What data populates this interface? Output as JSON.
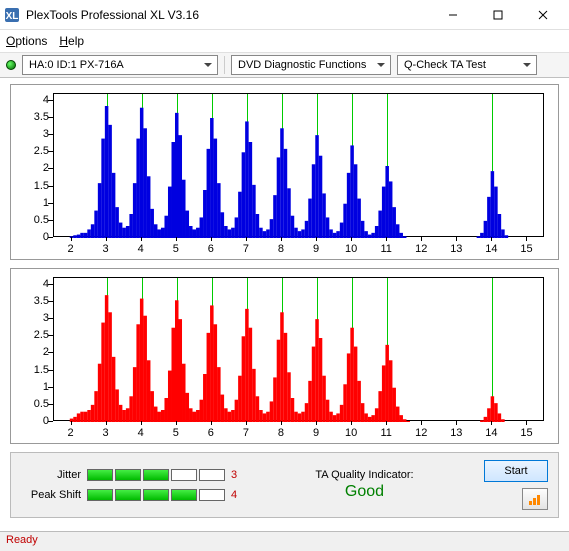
{
  "window": {
    "title": "PlexTools Professional XL V3.16"
  },
  "menu": {
    "options": "Options",
    "help": "Help"
  },
  "toolbar": {
    "drive": "HA:0 ID:1  PX-716A",
    "function_group": "DVD Diagnostic Functions",
    "test": "Q-Check TA Test"
  },
  "chart_data": [
    {
      "type": "bar",
      "color": "#0000e0",
      "xlim": [
        1.5,
        15.5
      ],
      "ylim": [
        0,
        4.2
      ],
      "xticks": [
        2,
        3,
        4,
        5,
        6,
        7,
        8,
        9,
        10,
        11,
        12,
        13,
        14,
        15
      ],
      "yticks": [
        0,
        0.5,
        1,
        1.5,
        2,
        2.5,
        3,
        3.5,
        4
      ],
      "gridlines_x": [
        3,
        4,
        5,
        6,
        7,
        8,
        9,
        10,
        11,
        14
      ],
      "series": [
        {
          "name": "top",
          "x": [
            2.0,
            2.1,
            2.2,
            2.3,
            2.4,
            2.5,
            2.6,
            2.7,
            2.8,
            2.9,
            3.0,
            3.1,
            3.2,
            3.3,
            3.4,
            3.5,
            3.6,
            3.7,
            3.8,
            3.9,
            4.0,
            4.1,
            4.2,
            4.3,
            4.4,
            4.5,
            4.6,
            4.7,
            4.8,
            4.9,
            5.0,
            5.1,
            5.2,
            5.3,
            5.4,
            5.5,
            5.6,
            5.7,
            5.8,
            5.9,
            6.0,
            6.1,
            6.2,
            6.3,
            6.4,
            6.5,
            6.6,
            6.7,
            6.8,
            6.9,
            7.0,
            7.1,
            7.2,
            7.3,
            7.4,
            7.5,
            7.6,
            7.7,
            7.8,
            7.9,
            8.0,
            8.1,
            8.2,
            8.3,
            8.4,
            8.5,
            8.6,
            8.7,
            8.8,
            8.9,
            9.0,
            9.1,
            9.2,
            9.3,
            9.4,
            9.5,
            9.6,
            9.7,
            9.8,
            9.9,
            10.0,
            10.1,
            10.2,
            10.3,
            10.4,
            10.5,
            10.6,
            10.7,
            10.8,
            10.9,
            11.0,
            11.1,
            11.2,
            11.3,
            11.4,
            11.5,
            13.6,
            13.7,
            13.8,
            13.9,
            14.0,
            14.1,
            14.2,
            14.3,
            14.4
          ],
          "y": [
            0.05,
            0.08,
            0.1,
            0.15,
            0.15,
            0.25,
            0.4,
            0.8,
            1.6,
            2.9,
            3.85,
            3.3,
            1.9,
            0.9,
            0.45,
            0.3,
            0.35,
            0.7,
            1.6,
            2.9,
            3.8,
            3.2,
            1.8,
            0.85,
            0.4,
            0.25,
            0.3,
            0.65,
            1.5,
            2.8,
            3.65,
            3.0,
            1.7,
            0.8,
            0.35,
            0.25,
            0.3,
            0.6,
            1.4,
            2.6,
            3.5,
            2.9,
            1.6,
            0.75,
            0.35,
            0.25,
            0.3,
            0.6,
            1.35,
            2.5,
            3.4,
            2.8,
            1.55,
            0.7,
            0.3,
            0.2,
            0.25,
            0.55,
            1.25,
            2.35,
            3.2,
            2.6,
            1.45,
            0.65,
            0.3,
            0.2,
            0.25,
            0.5,
            1.15,
            2.15,
            3.0,
            2.4,
            1.3,
            0.6,
            0.25,
            0.15,
            0.2,
            0.45,
            1.0,
            1.9,
            2.7,
            2.15,
            1.15,
            0.5,
            0.2,
            0.1,
            0.15,
            0.35,
            0.8,
            1.5,
            2.1,
            1.65,
            0.9,
            0.4,
            0.15,
            0.05,
            0.05,
            0.15,
            0.5,
            1.2,
            1.95,
            1.5,
            0.7,
            0.25,
            0.08
          ]
        }
      ]
    },
    {
      "type": "bar",
      "color": "#ff0000",
      "xlim": [
        1.5,
        15.5
      ],
      "ylim": [
        0,
        4.2
      ],
      "xticks": [
        2,
        3,
        4,
        5,
        6,
        7,
        8,
        9,
        10,
        11,
        12,
        13,
        14,
        15
      ],
      "yticks": [
        0,
        0.5,
        1,
        1.5,
        2,
        2.5,
        3,
        3.5,
        4
      ],
      "gridlines_x": [
        3,
        4,
        5,
        6,
        7,
        8,
        9,
        10,
        11,
        14
      ],
      "series": [
        {
          "name": "bottom",
          "x": [
            2.0,
            2.1,
            2.2,
            2.3,
            2.4,
            2.5,
            2.6,
            2.7,
            2.8,
            2.9,
            3.0,
            3.1,
            3.2,
            3.3,
            3.4,
            3.5,
            3.6,
            3.7,
            3.8,
            3.9,
            4.0,
            4.1,
            4.2,
            4.3,
            4.4,
            4.5,
            4.6,
            4.7,
            4.8,
            4.9,
            5.0,
            5.1,
            5.2,
            5.3,
            5.4,
            5.5,
            5.6,
            5.7,
            5.8,
            5.9,
            6.0,
            6.1,
            6.2,
            6.3,
            6.4,
            6.5,
            6.6,
            6.7,
            6.8,
            6.9,
            7.0,
            7.1,
            7.2,
            7.3,
            7.4,
            7.5,
            7.6,
            7.7,
            7.8,
            7.9,
            8.0,
            8.1,
            8.2,
            8.3,
            8.4,
            8.5,
            8.6,
            8.7,
            8.8,
            8.9,
            9.0,
            9.1,
            9.2,
            9.3,
            9.4,
            9.5,
            9.6,
            9.7,
            9.8,
            9.9,
            10.0,
            10.1,
            10.2,
            10.3,
            10.4,
            10.5,
            10.6,
            10.7,
            10.8,
            10.9,
            11.0,
            11.1,
            11.2,
            11.3,
            11.4,
            11.5,
            11.6,
            13.7,
            13.8,
            13.9,
            14.0,
            14.1,
            14.2,
            14.3
          ],
          "y": [
            0.1,
            0.15,
            0.25,
            0.3,
            0.3,
            0.35,
            0.5,
            0.9,
            1.7,
            2.9,
            3.7,
            3.2,
            1.9,
            0.95,
            0.5,
            0.35,
            0.4,
            0.75,
            1.6,
            2.85,
            3.6,
            3.1,
            1.8,
            0.9,
            0.45,
            0.3,
            0.35,
            0.7,
            1.5,
            2.75,
            3.55,
            3.0,
            1.7,
            0.85,
            0.4,
            0.3,
            0.35,
            0.65,
            1.4,
            2.6,
            3.4,
            2.85,
            1.6,
            0.8,
            0.4,
            0.3,
            0.35,
            0.65,
            1.35,
            2.5,
            3.3,
            2.75,
            1.55,
            0.75,
            0.35,
            0.25,
            0.3,
            0.6,
            1.3,
            2.4,
            3.2,
            2.6,
            1.45,
            0.7,
            0.3,
            0.25,
            0.3,
            0.55,
            1.2,
            2.2,
            3.0,
            2.45,
            1.35,
            0.65,
            0.3,
            0.2,
            0.25,
            0.5,
            1.1,
            2.0,
            2.75,
            2.2,
            1.2,
            0.55,
            0.25,
            0.15,
            0.2,
            0.4,
            0.9,
            1.65,
            2.25,
            1.8,
            1.0,
            0.45,
            0.2,
            0.08,
            0.03,
            0.05,
            0.15,
            0.4,
            0.75,
            0.55,
            0.25,
            0.08
          ]
        }
      ]
    }
  ],
  "meters": {
    "jitter": {
      "label": "Jitter",
      "value": 3,
      "max": 5
    },
    "peak_shift": {
      "label": "Peak Shift",
      "value": 4,
      "max": 5
    }
  },
  "ta_indicator": {
    "label": "TA Quality Indicator:",
    "value": "Good"
  },
  "buttons": {
    "start": "Start"
  },
  "status": {
    "text": "Ready"
  }
}
